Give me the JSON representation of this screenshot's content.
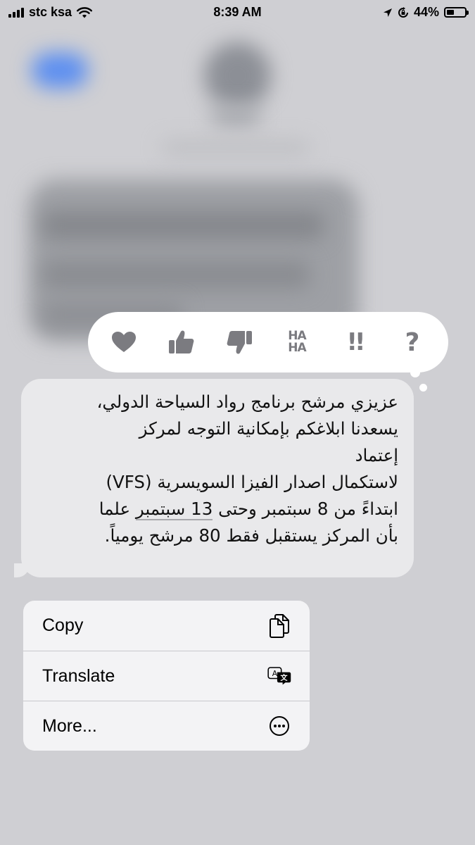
{
  "status_bar": {
    "carrier": "stc ksa",
    "time": "8:39 AM",
    "battery_percent": "44%",
    "battery_level": 0.44
  },
  "tapbacks": [
    {
      "name": "heart",
      "label": ""
    },
    {
      "name": "thumbs-up",
      "label": ""
    },
    {
      "name": "thumbs-down",
      "label": ""
    },
    {
      "name": "haha",
      "label_top": "HA",
      "label_bottom": "HA"
    },
    {
      "name": "exclamation",
      "label": "!!"
    },
    {
      "name": "question",
      "label": "?"
    }
  ],
  "message": {
    "lines": [
      "عزيزي مرشح برنامج رواد السياحة الدولي،",
      "يسعدنا ابلاغكم بإمكانية التوجه لمركز",
      "إعتماد",
      "لاستكمال اصدار الفيزا السويسرية (VFS)",
      "ابتداءً من 8 سبتمبر وحتى ",
      "بأن المركز يستقبل فقط 80 مرشح يومياً."
    ],
    "line5_underlined": "13 سبتمبر",
    "line5_end": " علما"
  },
  "menu": {
    "items": [
      {
        "label": "Copy",
        "icon": "copy-icon"
      },
      {
        "label": "Translate",
        "icon": "translate-icon"
      },
      {
        "label": "More...",
        "icon": "more-icon"
      }
    ]
  },
  "colors": {
    "bubble": "#e9e9eb",
    "tapback_icon": "#7b7b80",
    "menu_bg": "#f3f3f5"
  }
}
